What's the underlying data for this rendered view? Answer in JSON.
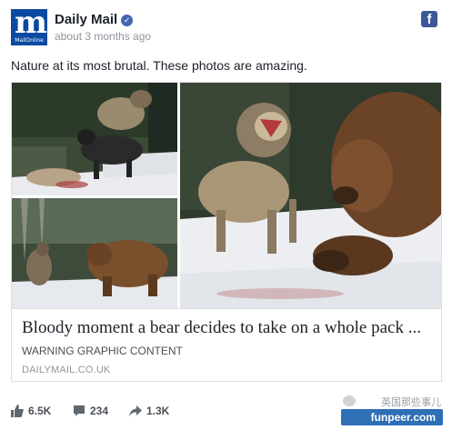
{
  "post": {
    "page_name": "Daily Mail",
    "avatar_letter": "m",
    "avatar_subtext": "MailOnline",
    "timestamp": "about 3 months ago",
    "facebook_icon_letter": "f",
    "text": "Nature at its most brutal. These photos are amazing."
  },
  "link_card": {
    "title": "Bloody moment a bear decides to take on a whole pack ...",
    "description": "WARNING GRAPHIC CONTENT",
    "domain": "DAILYMAIL.CO.UK"
  },
  "footer": {
    "likes": "6.5K",
    "comments": "234",
    "shares": "1.3K"
  },
  "watermark": {
    "top_text": "英国那些事儿",
    "site": "funpeer.com"
  },
  "colors": {
    "brand_blue": "#0b4aa1",
    "facebook_blue": "#3b5998",
    "verified_blue": "#4267b2",
    "watermark_blue": "#2f6fb6"
  },
  "icons": {
    "like": "thumbs-up-icon",
    "comment": "comment-bubble-icon",
    "share": "share-arrow-icon",
    "verified": "verified-check-icon",
    "facebook": "facebook-logo-icon"
  }
}
